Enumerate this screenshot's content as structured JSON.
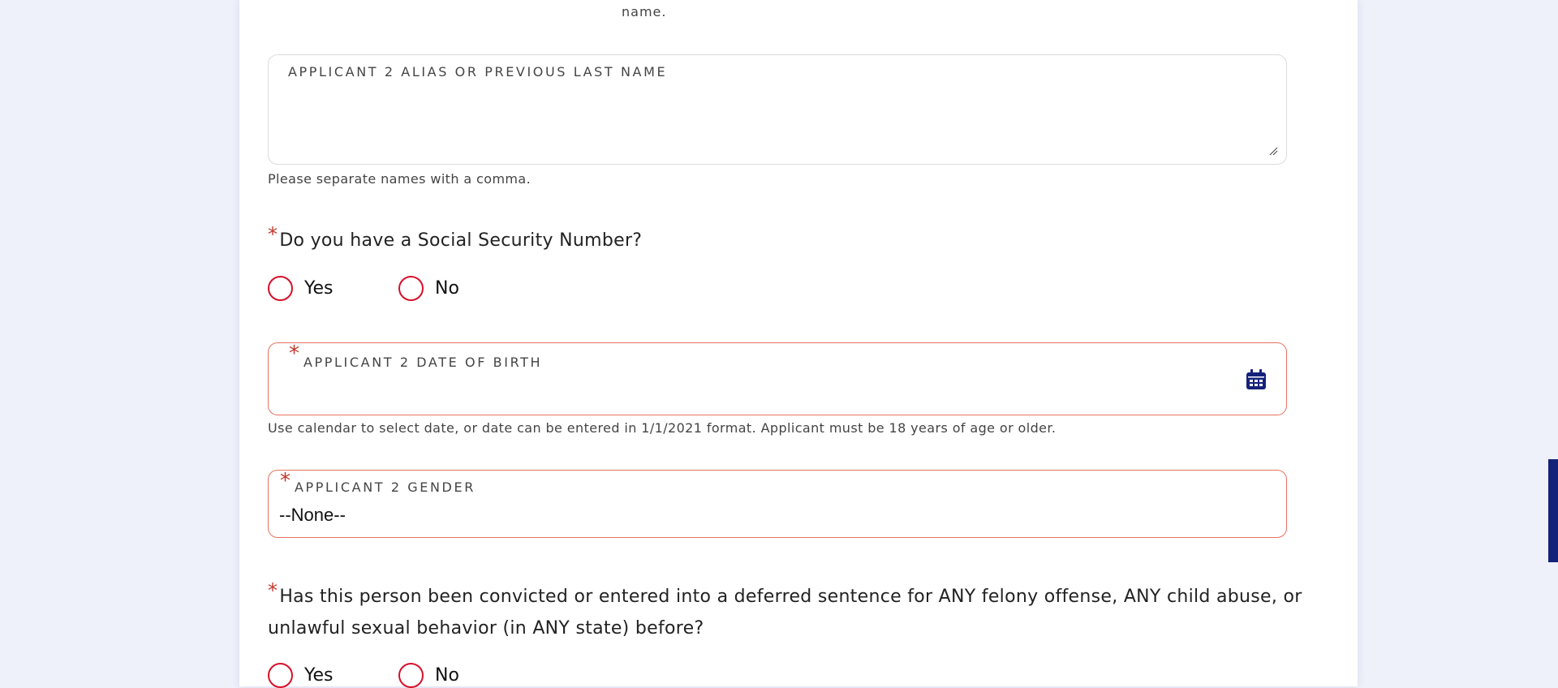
{
  "top_note": "name.",
  "alias": {
    "label": "APPLICANT 2 ALIAS OR PREVIOUS LAST NAME",
    "value": "",
    "help": "Please separate names with a comma."
  },
  "ssn_question": {
    "required_mark": "*",
    "text": "Do you have a Social Security Number?",
    "options": [
      "Yes",
      "No"
    ]
  },
  "dob": {
    "required_mark": "*",
    "label": "APPLICANT 2 DATE OF BIRTH",
    "value": "",
    "icon": "calendar-icon",
    "help": "Use calendar to select date, or date can be entered in 1/1/2021 format. Applicant must be 18 years of age or older."
  },
  "gender": {
    "required_mark": "*",
    "label": "APPLICANT 2 GENDER",
    "value": "--None--"
  },
  "felony_question": {
    "required_mark": "*",
    "text": "Has this person been convicted or entered into a deferred sentence for ANY felony offense, ANY child abuse, or unlawful sexual behavior (in ANY state) before?",
    "options": [
      "Yes",
      "No"
    ]
  },
  "colors": {
    "accent": "#d6112a",
    "error_border": "#e5735f",
    "brand": "#15227a",
    "background": "#eef0fa"
  }
}
